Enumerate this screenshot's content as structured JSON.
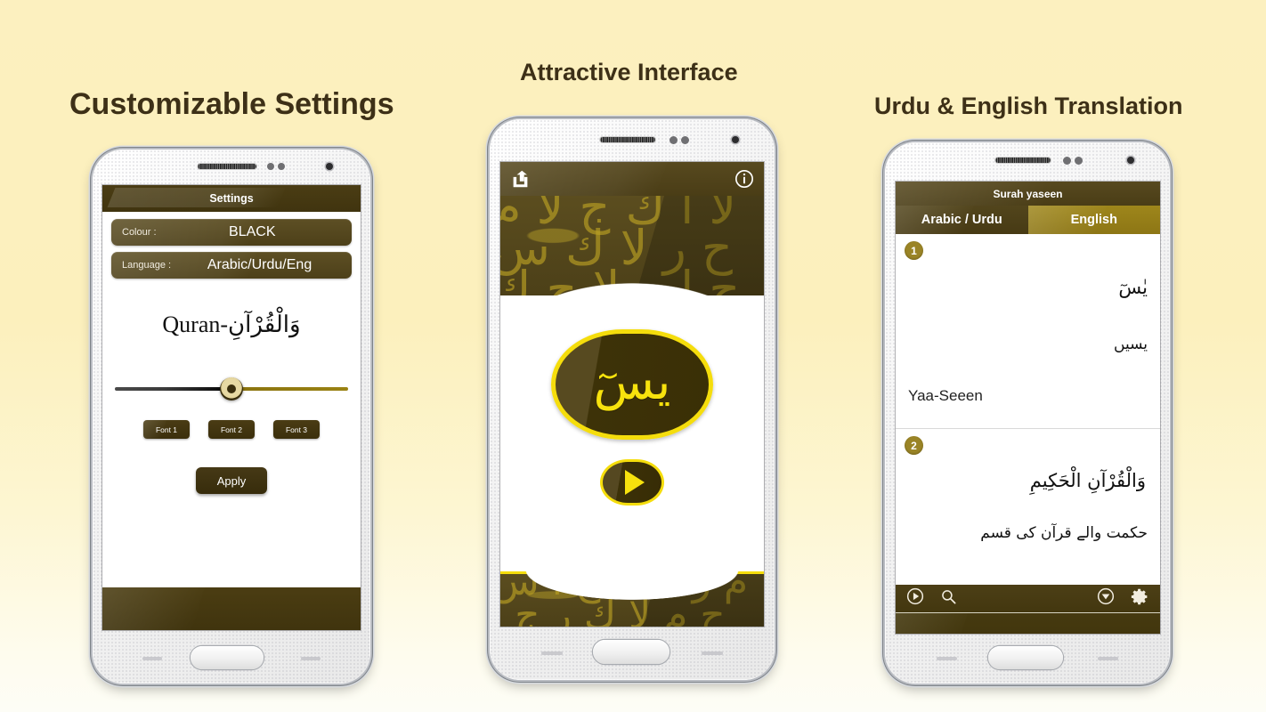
{
  "headings": {
    "left": "Customizable Settings",
    "middle": "Attractive Interface",
    "right": "Urdu & English Translation"
  },
  "colors": {
    "background_top": "#fcf0bf",
    "background_bottom": "#fdfdf6",
    "heading_text": "#3d3017",
    "brand_dark": "#4a3d16",
    "brand_gold": "#9e861b",
    "accent_yellow": "#f5dd0c",
    "badge_brown": "#9a8426"
  },
  "phone1": {
    "name": "Settings screen",
    "titlebar": "Settings",
    "rows": [
      {
        "label": "Colour :",
        "value": "BLACK"
      },
      {
        "label": "Language :",
        "value": "Arabic/Urdu/Eng"
      }
    ],
    "preview_text": "Quran-وَالْقُرْآنِ",
    "slider": {
      "name": "font-size-slider",
      "position_percent": 50
    },
    "font_buttons": [
      {
        "label": "Font 1",
        "selected": true
      },
      {
        "label": "Font 2",
        "selected": false
      },
      {
        "label": "Font 3",
        "selected": false
      }
    ],
    "apply_button": "Apply"
  },
  "phone2": {
    "name": "Splash / home screen",
    "appbar": {
      "share_icon": "share-icon",
      "info_icon": "info-icon"
    },
    "emblem_text": "يسٓ",
    "play_button": "play-icon",
    "background_motif": "arabic-calligraphy-pattern"
  },
  "phone3": {
    "name": "Surah translation screen",
    "titlebar": "Surah yaseen",
    "tabs": [
      {
        "label": "Arabic / Urdu",
        "active": false
      },
      {
        "label": "English",
        "active": true
      }
    ],
    "verses": [
      {
        "number": "1",
        "arabic": "يٰسٓ",
        "urdu": "یسیں",
        "english": "Yaa-Seeen"
      },
      {
        "number": "2",
        "arabic": "وَالْقُرْآنِ الْحَكِيمِ",
        "urdu": "حکمت والے قرآن کی قسم",
        "english": ""
      }
    ],
    "toolbar": {
      "play_icon": "play-circle-icon",
      "search_icon": "search-icon",
      "dropdown_icon": "chevron-down-circle-icon",
      "settings_icon": "gear-icon"
    }
  }
}
